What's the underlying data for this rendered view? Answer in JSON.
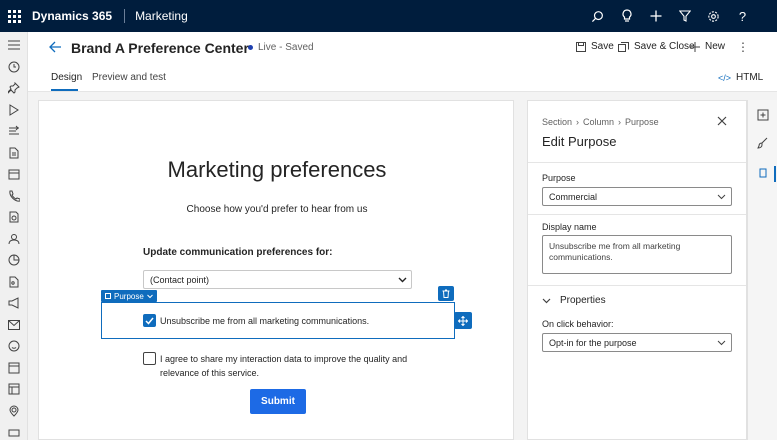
{
  "app": {
    "brand": "Dynamics 365",
    "area": "Marketing"
  },
  "commandbar": {
    "title": "Brand A Preference Center",
    "status": "Live - Saved",
    "save": "Save",
    "save_close": "Save & Close",
    "new": "New"
  },
  "tabs": {
    "design": "Design",
    "preview": "Preview and test",
    "html": "HTML"
  },
  "canvas": {
    "heading": "Marketing preferences",
    "subheading": "Choose how you'd prefer to hear from us",
    "update_label": "Update communication preferences for:",
    "contact_point_select": "(Contact point)",
    "purpose_tag": "Purpose",
    "checkbox1_label": "Unsubscribe me from all marketing communications.",
    "checkbox1_checked": true,
    "checkbox2_label": "I agree to share my interaction data to improve the quality and relevance of this service.",
    "checkbox2_checked": false,
    "submit": "Submit"
  },
  "panel": {
    "breadcrumb": [
      "Section",
      "Column",
      "Purpose"
    ],
    "title": "Edit Purpose",
    "purpose_label": "Purpose",
    "purpose_value": "Commercial",
    "display_name_label": "Display name",
    "display_name_value": "Unsubscribe me from all marketing communications.",
    "properties": "Properties",
    "onclick_label": "On click behavior:",
    "onclick_value": "Opt-in for the purpose"
  },
  "colors": {
    "topbar": "#001d3d",
    "accent": "#0f6cbd",
    "submit": "#1d6ae5"
  }
}
